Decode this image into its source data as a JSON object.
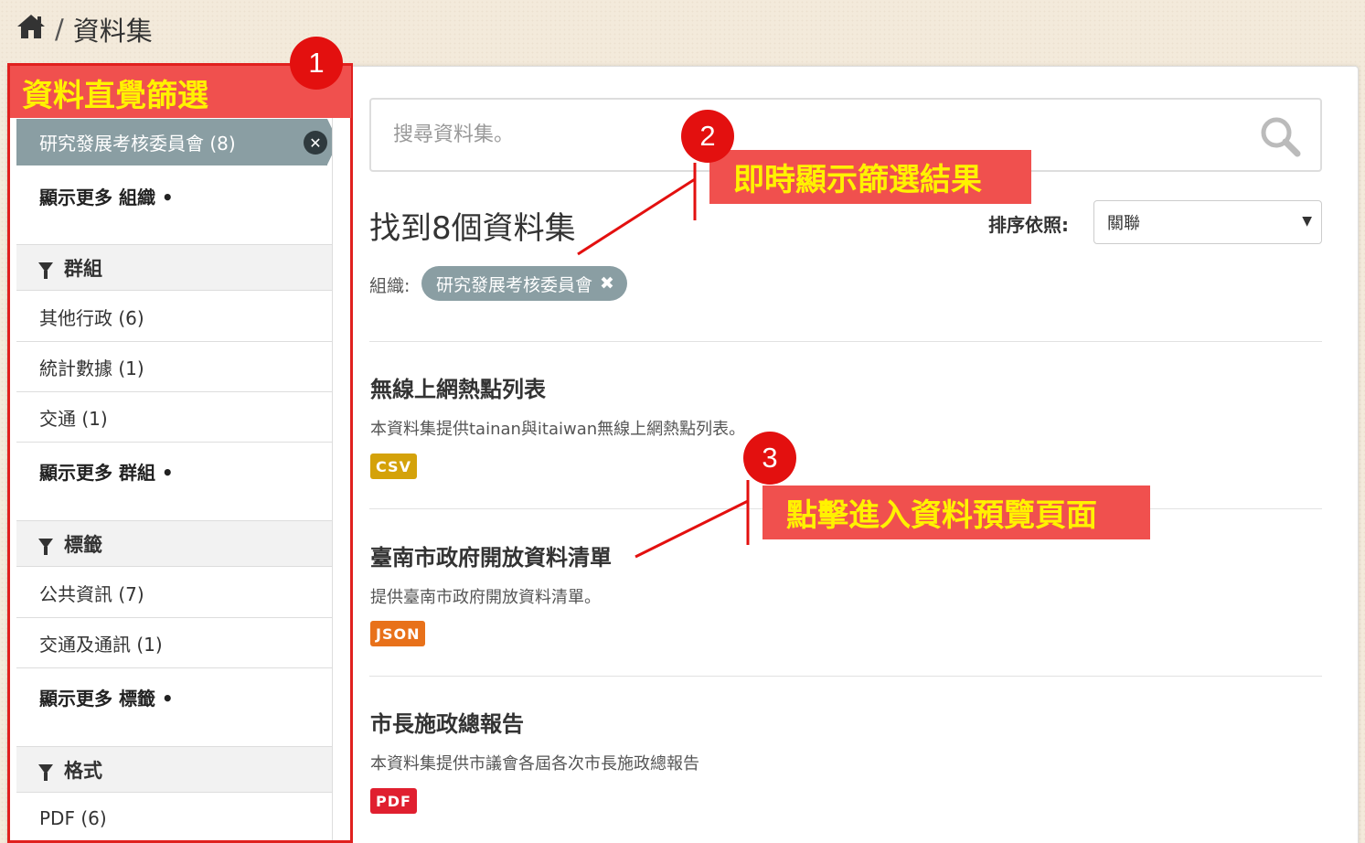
{
  "breadcrumb": {
    "home_icon": "home-icon",
    "separator": "/",
    "current": "資料集"
  },
  "sidebar": {
    "active_filter": "研究發展考核委員會 (8)",
    "active_remove_icon": "close-circle-icon",
    "show_more_org": "顯示更多 組織 •",
    "groups": {
      "title": "群組",
      "items": [
        "其他行政 (6)",
        "統計數據 (1)",
        "交通 (1)"
      ],
      "show_more": "顯示更多 群組 •"
    },
    "tags": {
      "title": "標籤",
      "items": [
        "公共資訊 (7)",
        "交通及通訊 (1)"
      ],
      "show_more": "顯示更多 標籤 •"
    },
    "formats": {
      "title": "格式",
      "items": [
        "PDF (6)"
      ]
    }
  },
  "search": {
    "placeholder": "搜尋資料集。",
    "icon": "search-icon"
  },
  "results": {
    "count_text": "找到8個資料集",
    "sort_label": "排序依照:",
    "sort_value": "關聯",
    "filter_label": "組織:",
    "filter_tag": "研究發展考核委員會",
    "filter_tag_remove": "✖"
  },
  "datasets": [
    {
      "title": "無線上網熱點列表",
      "description": "本資料集提供tainan與itaiwan無線上網熱點列表。",
      "format": "CSV",
      "format_color": "#d4a20a"
    },
    {
      "title": "臺南市政府開放資料清單",
      "description": "提供臺南市政府開放資料清單。",
      "format": "JSON",
      "format_color": "#e8711a"
    },
    {
      "title": "市長施政總報告",
      "description": "本資料集提供市議會各屆各次市長施政總報告",
      "format": "PDF",
      "format_color": "#e01f2f"
    }
  ],
  "annotations": {
    "one": {
      "number": "1",
      "label": "資料直覺篩選"
    },
    "two": {
      "number": "2",
      "label": "即時顯示篩選結果"
    },
    "three": {
      "number": "3",
      "label": "點擊進入資料預覽頁面"
    },
    "color": "#e3100f",
    "label_bg": "#f0504e",
    "label_text_color": "#fff200"
  }
}
